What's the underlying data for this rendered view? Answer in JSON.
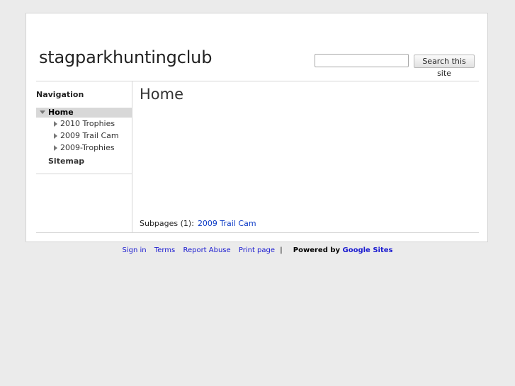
{
  "site": {
    "title": "stagparkhuntingclub"
  },
  "search": {
    "button_label": "Search this site",
    "value": ""
  },
  "nav": {
    "heading": "Navigation",
    "home": "Home",
    "subitems": [
      "2010 Trophies",
      "2009 Trail Cam",
      "2009-Trophies"
    ],
    "sitemap": "Sitemap"
  },
  "main": {
    "title": "Home",
    "subpages_label": "Subpages (1):",
    "subpages": [
      "2009 Trail Cam"
    ]
  },
  "footer": {
    "links": [
      "Sign in",
      "Terms",
      "Report Abuse",
      "Print page"
    ],
    "divider": "|",
    "powered_by": "Powered by",
    "brand": "Google Sites"
  }
}
